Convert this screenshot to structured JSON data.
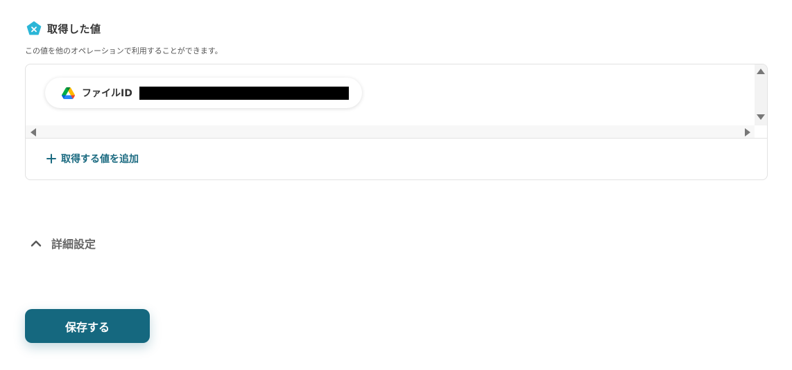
{
  "section": {
    "icon": "brand-pentagon-x-icon",
    "title": "取得した値",
    "description": "この値を他のオペレーションで利用することができます。"
  },
  "values": {
    "items": [
      {
        "icon": "google-drive-icon",
        "label": "ファイルID",
        "value": ""
      }
    ],
    "add_label": "取得する値を追加"
  },
  "advanced": {
    "label": "詳細設定",
    "expanded": true
  },
  "actions": {
    "save_label": "保存する"
  },
  "colors": {
    "accent": "#15687f",
    "link": "#1a6a80",
    "brand_icon": "#2bb6d7",
    "border": "#e2e2e2"
  }
}
